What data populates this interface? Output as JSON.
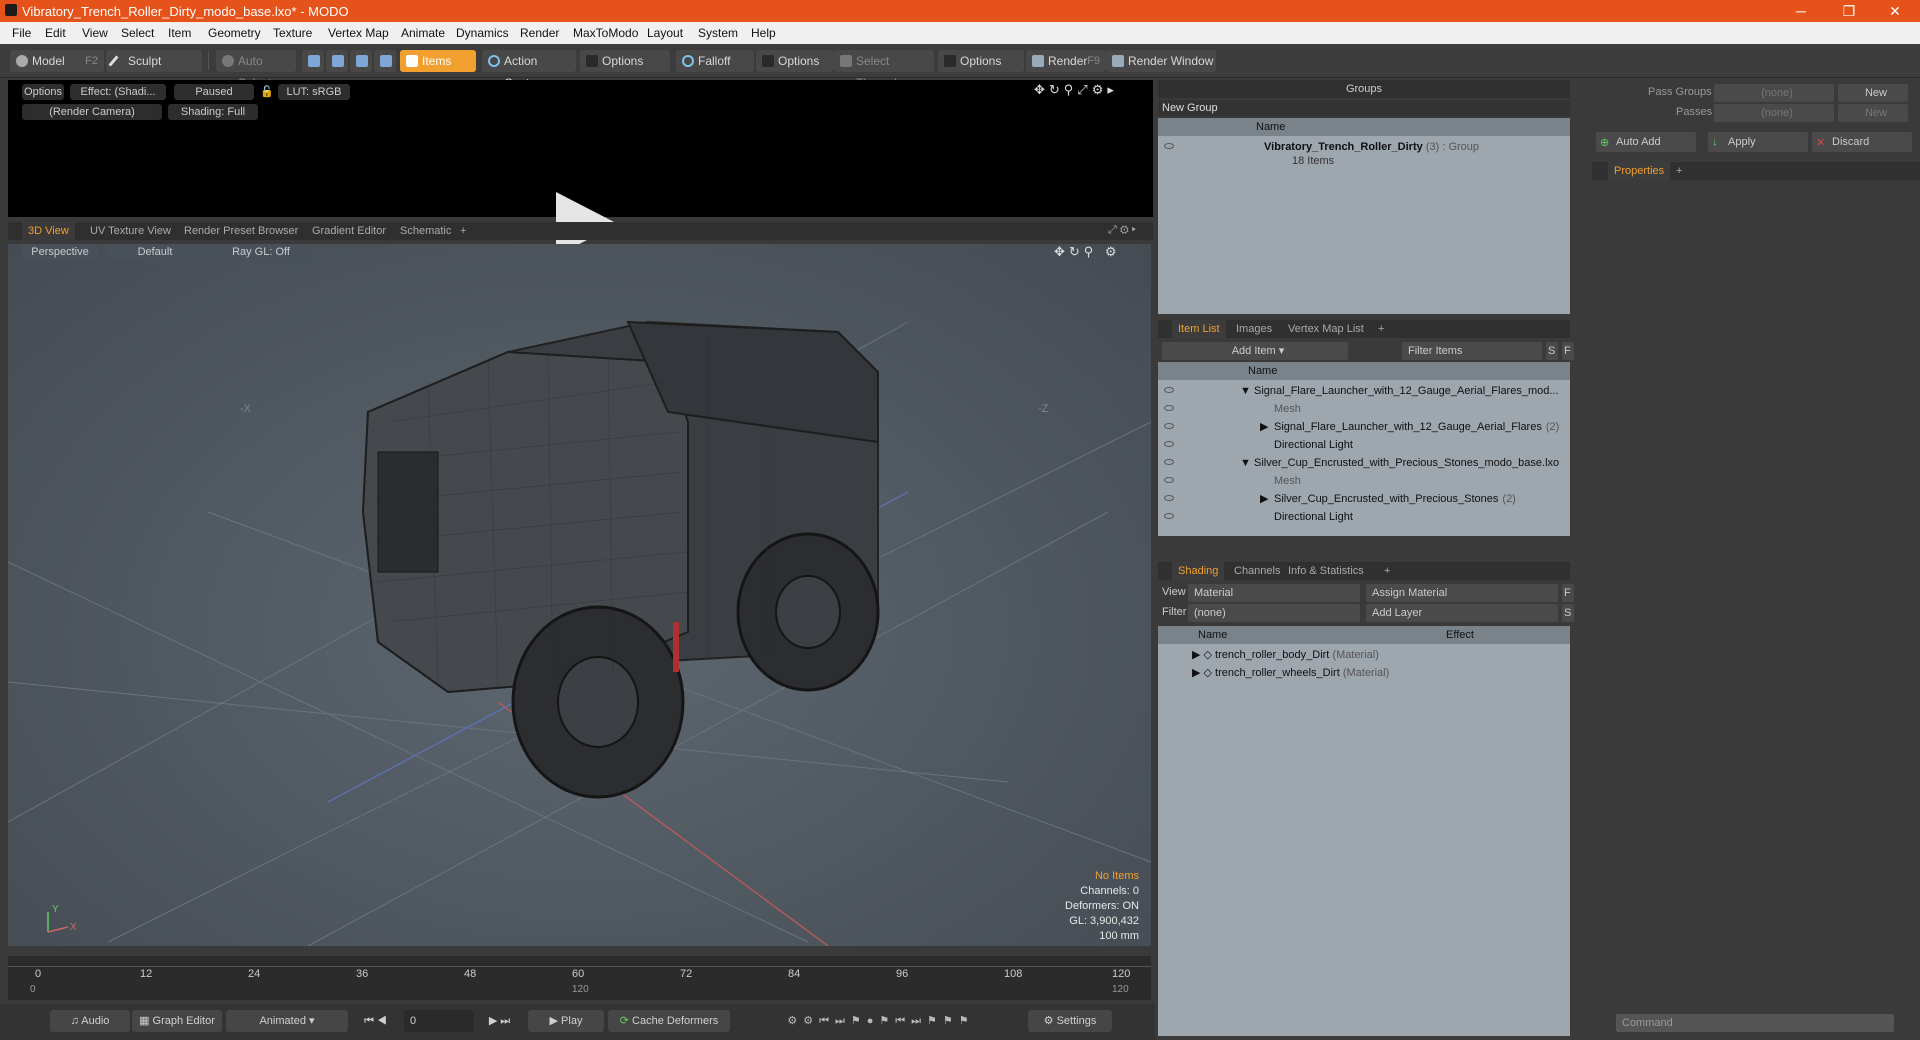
{
  "window": {
    "title": "Vibratory_Trench_Roller_Dirty_modo_base.lxo* - MODO",
    "controls": [
      "─",
      "❐",
      "✕"
    ]
  },
  "menu": [
    "File",
    "Edit",
    "View",
    "Select",
    "Item",
    "Geometry",
    "Texture",
    "Vertex Map",
    "Animate",
    "Dynamics",
    "Render",
    "MaxToModo",
    "Layout",
    "System",
    "Help"
  ],
  "toolbar": {
    "model": "Model",
    "model_key": "F2",
    "sculpt": "Sculpt",
    "auto_select": "Auto Select",
    "items": "Items",
    "action_center": "Action Center",
    "options1": "Options",
    "falloff": "Falloff",
    "options2": "Options",
    "select_through": "Select Through",
    "options3": "Options",
    "render": "Render",
    "render_key": "F9",
    "render_window": "Render Window"
  },
  "preview": {
    "options": "Options",
    "effect": "Effect: (Shadi...",
    "paused": "Paused",
    "lut": "LUT: sRGB",
    "camera": "(Render Camera)",
    "shading": "Shading: Full"
  },
  "viewtabs": [
    "3D View",
    "UV Texture View",
    "Render Preset Browser",
    "Gradient Editor",
    "Schematic",
    "+"
  ],
  "viewport": {
    "perspective": "Perspective",
    "default": "Default",
    "raygl": "Ray GL: Off",
    "axis_left": "-X",
    "axis_right": "-Z",
    "no_items": "No Items",
    "channels": "Channels: 0",
    "deformers": "Deformers: ON",
    "gl": "GL: 3,900,432",
    "scale": "100 mm",
    "gizmo_y": "Y",
    "gizmo_x": "X"
  },
  "timeline": {
    "ticks": [
      "0",
      "12",
      "24",
      "36",
      "48",
      "60",
      "72",
      "84",
      "96",
      "108",
      "120"
    ],
    "lower_left": "0",
    "lower_mid": "120",
    "lower_right": "120"
  },
  "bottombar": {
    "audio": "Audio",
    "graph_editor": "Graph Editor",
    "animated": "Animated",
    "frame": "0",
    "play": "Play",
    "cache": "Cache Deformers",
    "settings": "Settings"
  },
  "groups": {
    "header": "Groups",
    "new_group": "New Group",
    "col_name": "Name",
    "item_name": "Vibratory_Trench_Roller_Dirty",
    "item_count": "(3)",
    "item_type": ": Group",
    "item_sub": "18 Items"
  },
  "right": {
    "pass_groups": "Pass Groups",
    "passes": "Passes",
    "none1": "(none)",
    "none2": "(none)",
    "new1": "New",
    "new2": "New",
    "auto_add": "Auto Add",
    "apply": "Apply",
    "discard": "Discard",
    "properties": "Properties",
    "plus": "+"
  },
  "itemlist": {
    "tabs": [
      "Item List",
      "Images",
      "Vertex Map List",
      "+"
    ],
    "add_item": "Add Item",
    "filter": "Filter Items",
    "s": "S",
    "f": "F",
    "col_name": "Name",
    "rows": [
      {
        "text": "Signal_Flare_Launcher_with_12_Gauge_Aerial_Flares_mod...",
        "indent": 0,
        "arrow": "▼",
        "dim": false,
        "extra": ""
      },
      {
        "text": "Mesh",
        "indent": 1,
        "arrow": "",
        "dim": true,
        "extra": ""
      },
      {
        "text": "Signal_Flare_Launcher_with_12_Gauge_Aerial_Flares",
        "indent": 1,
        "arrow": "▶",
        "dim": false,
        "extra": "(2)"
      },
      {
        "text": "Directional Light",
        "indent": 1,
        "arrow": "",
        "dim": false,
        "extra": ""
      },
      {
        "text": "Silver_Cup_Encrusted_with_Precious_Stones_modo_base.lxo",
        "indent": 0,
        "arrow": "▼",
        "dim": false,
        "extra": ""
      },
      {
        "text": "Mesh",
        "indent": 1,
        "arrow": "",
        "dim": true,
        "extra": ""
      },
      {
        "text": "Silver_Cup_Encrusted_with_Precious_Stones",
        "indent": 1,
        "arrow": "▶",
        "dim": false,
        "extra": "(2)"
      },
      {
        "text": "Directional Light",
        "indent": 1,
        "arrow": "",
        "dim": false,
        "extra": ""
      }
    ]
  },
  "shading": {
    "tabs": [
      "Shading",
      "Channels",
      "Info & Statistics",
      "+"
    ],
    "view_label": "View",
    "view_value": "Material",
    "assign": "Assign Material",
    "filter_label": "Filter",
    "filter_value": "(none)",
    "add_layer": "Add Layer",
    "f": "F",
    "s": "S",
    "col_name": "Name",
    "col_effect": "Effect",
    "rows": [
      {
        "name": "trench_roller_body_Dirt",
        "type": "(Material)"
      },
      {
        "name": "trench_roller_wheels_Dirt",
        "type": "(Material)"
      }
    ]
  },
  "command": {
    "placeholder": "Command"
  }
}
